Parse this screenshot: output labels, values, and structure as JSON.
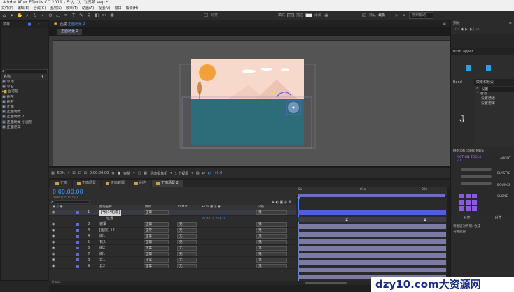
{
  "window_title": "Adobe After Effects CC 2019 - E:\\\\...\\\\...\\\\视频.aep *",
  "menu": [
    "文件(F)",
    "编辑(E)",
    "合成(C)",
    "图层(L)",
    "效果(T)",
    "动画(A)",
    "视图(V)",
    "窗口",
    "帮助(H)"
  ],
  "toolbar": {
    "align_label": "对齐",
    "fill_label": "填充",
    "stroke_label": "描边",
    "add_label": "添加",
    "workspace_default": "默认",
    "workspace_current": "最新",
    "search_placeholder": "搜索帮助"
  },
  "project_panel": {
    "tab": "项目",
    "search_placeholder": "",
    "column_name": "名称",
    "items": [
      {
        "name": "草地",
        "color": "#4a7fd1"
      },
      {
        "name": "草右",
        "color": "#4a7fd1"
      },
      {
        "name": "固态层",
        "color": "#cfae3b",
        "folder": true
      },
      {
        "name": "树左",
        "color": "#4a7fd1"
      },
      {
        "name": "树右",
        "color": "#4a7fd1"
      },
      {
        "name": "正面",
        "color": "#4a7fd1"
      },
      {
        "name": "正面场景",
        "color": "#4a7fd1"
      },
      {
        "name": "正面场景 2",
        "color": "#4a7fd1"
      },
      {
        "name": "正面场景 小图层",
        "color": "#4a7fd1"
      },
      {
        "name": "正面遮罩",
        "color": "#4a7fd1"
      }
    ]
  },
  "composition": {
    "tab": "合成",
    "name": "正面场景 2",
    "breadcrumb": "正面场景 2"
  },
  "viewbar": {
    "zoom": "50%",
    "timecode": "0:00:00:00",
    "quality": "完整",
    "camera": "活动摄像机",
    "views": "1 个视图",
    "exposure": "+0.0"
  },
  "timeline": {
    "tabs": [
      "正面",
      "正面场景",
      "正面遮罩",
      "树右",
      "正面场景 2"
    ],
    "active_tab": "正面场景 2",
    "timecode": "0:00:00:00",
    "fps": "00000 (25.00 fps)",
    "header_labels": {
      "source": "图层名称",
      "mode": "模式",
      "trkmat": "TrkMat",
      "parent": "父级"
    },
    "layers": [
      {
        "num": "1",
        "name": "[*树1*轮廓]",
        "mode": "正常",
        "trk": "",
        "parent": "无",
        "selected": true
      },
      {
        "num": "",
        "name": "位置",
        "mode": "",
        "trk": "",
        "parent": "",
        "value": "2187.2,258.0",
        "sub": true
      },
      {
        "num": "2",
        "name": "遮罩",
        "mode": "正常",
        "trk": "无",
        "parent": "无"
      },
      {
        "num": "3",
        "name": "[图层] 12",
        "mode": "正常",
        "trk": "无",
        "parent": "无"
      },
      {
        "num": "4",
        "name": "树1",
        "mode": "正常",
        "trk": "无",
        "parent": "无"
      },
      {
        "num": "5",
        "name": "石头",
        "mode": "正常",
        "trk": "无",
        "parent": "无"
      },
      {
        "num": "6",
        "name": "树2",
        "mode": "正常",
        "trk": "无",
        "parent": "无"
      },
      {
        "num": "7",
        "name": "树1",
        "mode": "正常",
        "trk": "无",
        "parent": "无"
      },
      {
        "num": "8",
        "name": "云1",
        "mode": "正常",
        "trk": "无",
        "parent": "无"
      },
      {
        "num": "9",
        "name": "云2",
        "mode": "正常",
        "trk": "无",
        "parent": "无"
      }
    ],
    "ruler_marks": [
      "0s",
      "01s",
      "02s"
    ],
    "footer": "8 bpc"
  },
  "right_panels": {
    "preview_tab": "预览",
    "buttcapper_tab": "ButtCapper",
    "bend_tab": "Bend",
    "effects_tab": "效果和预设",
    "effects_search": "设置",
    "effects_items": [
      "* 通道",
      "设置通道",
      "设置遮罩"
    ],
    "motion_tools_tab": "Motion Tools MDS",
    "motion_tools_logo": "MOTION TOOLS v.1",
    "motion_tools_about": "ABOUT",
    "elastic_label": "ELASTIC",
    "bounce_label": "BOUNCE",
    "clone_label": "CLONE",
    "align_tab": "对齐",
    "align_tab2": "对齐",
    "layer_align_label": "将图层对齐到:",
    "layer_align_value": "合成",
    "distribute_label": "分布图层:"
  },
  "watermark": "dzy10.com大资源网"
}
